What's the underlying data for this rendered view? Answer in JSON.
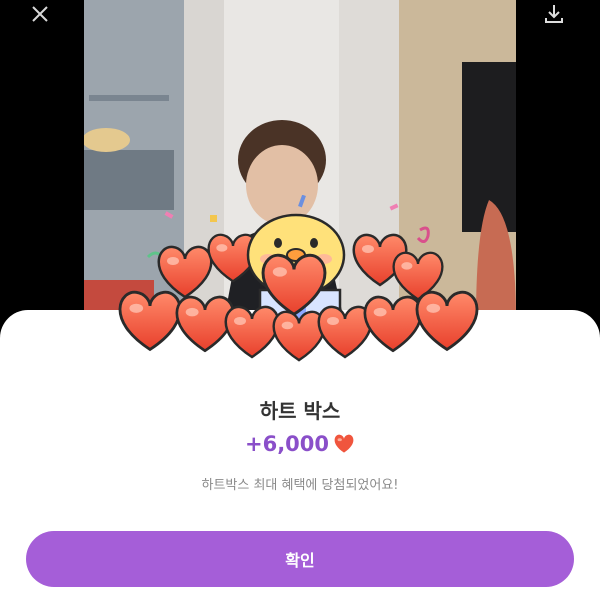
{
  "topbar": {
    "close_icon": "close-icon",
    "share_icon": "share-icon",
    "download_icon": "download-icon"
  },
  "reward": {
    "title": "하트 박스",
    "amount": "+6,000",
    "amount_icon": "heart-icon",
    "description": "하트박스 최대 혜택에 당첨되었어요!"
  },
  "actions": {
    "confirm_label": "확인"
  },
  "colors": {
    "accent": "#a55ed8",
    "amount_text": "#8a4fc9",
    "heart": "#f0553d"
  }
}
